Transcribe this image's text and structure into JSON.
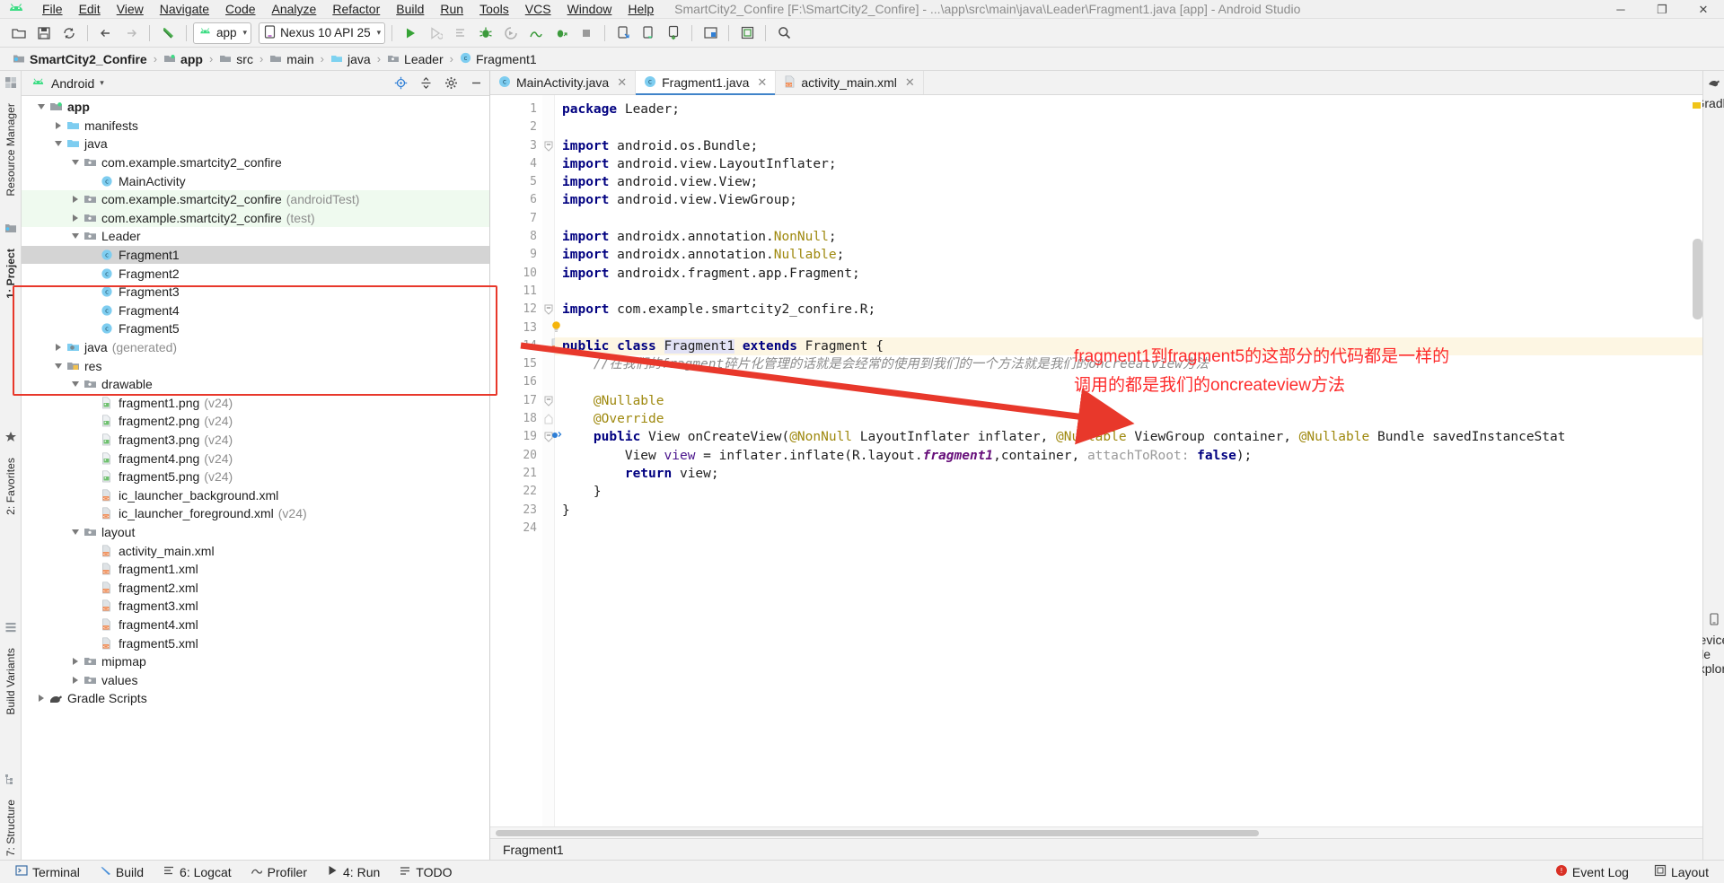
{
  "window": {
    "title": "SmartCity2_Confire [F:\\SmartCity2_Confire] - ...\\app\\src\\main\\java\\Leader\\Fragment1.java [app] - Android Studio",
    "minimize_label": "─",
    "maximize_label": "❐",
    "close_label": "✕"
  },
  "menubar": {
    "items": [
      {
        "label": "File"
      },
      {
        "label": "Edit"
      },
      {
        "label": "View"
      },
      {
        "label": "Navigate"
      },
      {
        "label": "Code"
      },
      {
        "label": "Analyze"
      },
      {
        "label": "Refactor"
      },
      {
        "label": "Build"
      },
      {
        "label": "Run"
      },
      {
        "label": "Tools"
      },
      {
        "label": "VCS"
      },
      {
        "label": "Window"
      },
      {
        "label": "Help"
      }
    ]
  },
  "toolbar": {
    "open_icon": "open-folder-icon",
    "save_icon": "save-icon",
    "sync_icon": "sync-project-icon",
    "back_icon": "navigate-back-icon",
    "forward_icon": "navigate-forward-icon",
    "undo_icon": "undo-icon",
    "module_combo": {
      "label": "app",
      "icon": "android-module-icon",
      "caret": "▾"
    },
    "device_combo": {
      "label": "Nexus 10 API 25",
      "icon": "device-icon",
      "caret": "▾"
    },
    "run_icon": "run-icon",
    "apply_changes_icon": "apply-changes-icon",
    "apply_code_changes_icon": "apply-code-changes-icon",
    "debug_icon": "debug-icon",
    "run_coverage_icon": "run-with-coverage-icon",
    "profile_icon": "profiler-icon",
    "attach_debugger_icon": "attach-debugger-icon",
    "stop_icon": "stop-icon",
    "avd_manager_icon": "avd-manager-icon",
    "sdk_manager_icon": "sdk-manager-icon",
    "device_file_explorer_icon": "device-explorer-icon",
    "project_structure_icon": "project-structure-icon",
    "layout_inspector_icon": "layout-inspector-icon",
    "search_icon": "search-everywhere-icon"
  },
  "breadcrumb": {
    "items": [
      {
        "label": "SmartCity2_Confire",
        "icon": "project-icon",
        "bold": true
      },
      {
        "label": "app",
        "icon": "module-icon",
        "bold": true
      },
      {
        "label": "src",
        "icon": "folder-icon",
        "bold": false
      },
      {
        "label": "main",
        "icon": "folder-icon",
        "bold": false
      },
      {
        "label": "java",
        "icon": "source-folder-icon",
        "bold": false
      },
      {
        "label": "Leader",
        "icon": "package-icon",
        "bold": false
      },
      {
        "label": "Fragment1",
        "icon": "class-icon",
        "bold": false
      }
    ],
    "separator": "›"
  },
  "left_rail": {
    "items": [
      {
        "label": "Resource Manager",
        "icon": "resource-manager-icon"
      },
      {
        "label": "1: Project",
        "icon": "project-tool-icon"
      },
      {
        "label": "2: Favorites",
        "icon": "favorites-icon"
      },
      {
        "label": "Build Variants",
        "icon": "build-variants-icon"
      },
      {
        "label": "7: Structure",
        "icon": "structure-icon"
      }
    ]
  },
  "right_rail": {
    "items": [
      {
        "label": "Gradle",
        "icon": "gradle-icon"
      },
      {
        "label": "Device File Explorer",
        "icon": "device-file-explorer-icon"
      }
    ]
  },
  "project_panel": {
    "view_selector": {
      "label": "Android",
      "icon": "android-head-icon",
      "caret": "▾"
    },
    "header_buttons": [
      {
        "name": "locate-icon",
        "label": "⌖"
      },
      {
        "name": "collapse-all-icon",
        "label": "⤓"
      },
      {
        "name": "settings-gear-icon",
        "label": "⚙"
      },
      {
        "name": "hide-panel-icon",
        "label": "─"
      }
    ],
    "tree": [
      {
        "indent": 0,
        "twisty": "down",
        "icon": "module-icon",
        "label": "app",
        "bold": true,
        "suffix": ""
      },
      {
        "indent": 1,
        "twisty": "right",
        "icon": "folder-icon",
        "label": "manifests",
        "bold": false,
        "suffix": ""
      },
      {
        "indent": 1,
        "twisty": "down",
        "icon": "folder-icon",
        "label": "java",
        "bold": false,
        "suffix": ""
      },
      {
        "indent": 2,
        "twisty": "down",
        "icon": "package-icon",
        "label": "com.example.smartcity2_confire",
        "bold": false,
        "suffix": ""
      },
      {
        "indent": 3,
        "twisty": "none",
        "icon": "class-icon",
        "label": "MainActivity",
        "bold": false,
        "suffix": ""
      },
      {
        "indent": 2,
        "twisty": "right",
        "icon": "package-icon",
        "label": "com.example.smartcity2_confire",
        "bold": false,
        "suffix": "(androidTest)",
        "bg": "test"
      },
      {
        "indent": 2,
        "twisty": "right",
        "icon": "package-icon",
        "label": "com.example.smartcity2_confire",
        "bold": false,
        "suffix": "(test)",
        "bg": "test"
      },
      {
        "indent": 2,
        "twisty": "down",
        "icon": "package-icon",
        "label": "Leader",
        "bold": false,
        "suffix": ""
      },
      {
        "indent": 3,
        "twisty": "none",
        "icon": "class-icon",
        "label": "Fragment1",
        "bold": false,
        "suffix": "",
        "bg": "sel"
      },
      {
        "indent": 3,
        "twisty": "none",
        "icon": "class-icon",
        "label": "Fragment2",
        "bold": false,
        "suffix": ""
      },
      {
        "indent": 3,
        "twisty": "none",
        "icon": "class-icon",
        "label": "Fragment3",
        "bold": false,
        "suffix": ""
      },
      {
        "indent": 3,
        "twisty": "none",
        "icon": "class-icon",
        "label": "Fragment4",
        "bold": false,
        "suffix": ""
      },
      {
        "indent": 3,
        "twisty": "none",
        "icon": "class-icon",
        "label": "Fragment5",
        "bold": false,
        "suffix": ""
      },
      {
        "indent": 1,
        "twisty": "right",
        "icon": "generated-folder-icon",
        "label": "java",
        "bold": false,
        "suffix": "(generated)"
      },
      {
        "indent": 1,
        "twisty": "down",
        "icon": "res-folder-icon",
        "label": "res",
        "bold": false,
        "suffix": ""
      },
      {
        "indent": 2,
        "twisty": "down",
        "icon": "package-icon",
        "label": "drawable",
        "bold": false,
        "suffix": ""
      },
      {
        "indent": 3,
        "twisty": "none",
        "icon": "image-file-icon",
        "label": "fragment1.png",
        "bold": false,
        "suffix": "(v24)"
      },
      {
        "indent": 3,
        "twisty": "none",
        "icon": "image-file-icon",
        "label": "fragment2.png",
        "bold": false,
        "suffix": "(v24)"
      },
      {
        "indent": 3,
        "twisty": "none",
        "icon": "image-file-icon",
        "label": "fragment3.png",
        "bold": false,
        "suffix": "(v24)"
      },
      {
        "indent": 3,
        "twisty": "none",
        "icon": "image-file-icon",
        "label": "fragment4.png",
        "bold": false,
        "suffix": "(v24)"
      },
      {
        "indent": 3,
        "twisty": "none",
        "icon": "image-file-icon",
        "label": "fragment5.png",
        "bold": false,
        "suffix": "(v24)"
      },
      {
        "indent": 3,
        "twisty": "none",
        "icon": "xml-file-icon",
        "label": "ic_launcher_background.xml",
        "bold": false,
        "suffix": ""
      },
      {
        "indent": 3,
        "twisty": "none",
        "icon": "xml-file-icon",
        "label": "ic_launcher_foreground.xml",
        "bold": false,
        "suffix": "(v24)"
      },
      {
        "indent": 2,
        "twisty": "down",
        "icon": "package-icon",
        "label": "layout",
        "bold": false,
        "suffix": ""
      },
      {
        "indent": 3,
        "twisty": "none",
        "icon": "xml-file-icon",
        "label": "activity_main.xml",
        "bold": false,
        "suffix": ""
      },
      {
        "indent": 3,
        "twisty": "none",
        "icon": "xml-file-icon",
        "label": "fragment1.xml",
        "bold": false,
        "suffix": ""
      },
      {
        "indent": 3,
        "twisty": "none",
        "icon": "xml-file-icon",
        "label": "fragment2.xml",
        "bold": false,
        "suffix": ""
      },
      {
        "indent": 3,
        "twisty": "none",
        "icon": "xml-file-icon",
        "label": "fragment3.xml",
        "bold": false,
        "suffix": ""
      },
      {
        "indent": 3,
        "twisty": "none",
        "icon": "xml-file-icon",
        "label": "fragment4.xml",
        "bold": false,
        "suffix": ""
      },
      {
        "indent": 3,
        "twisty": "none",
        "icon": "xml-file-icon",
        "label": "fragment5.xml",
        "bold": false,
        "suffix": ""
      },
      {
        "indent": 2,
        "twisty": "right",
        "icon": "package-icon",
        "label": "mipmap",
        "bold": false,
        "suffix": ""
      },
      {
        "indent": 2,
        "twisty": "right",
        "icon": "package-icon",
        "label": "values",
        "bold": false,
        "suffix": ""
      },
      {
        "indent": 0,
        "twisty": "right",
        "icon": "gradle-elephant-icon",
        "label": "Gradle Scripts",
        "bold": false,
        "suffix": ""
      }
    ]
  },
  "editor": {
    "tabs": [
      {
        "label": "MainActivity.java",
        "icon": "java-class-icon",
        "active": false,
        "close": "✕"
      },
      {
        "label": "Fragment1.java",
        "icon": "java-class-icon",
        "active": true,
        "close": "✕"
      },
      {
        "label": "activity_main.xml",
        "icon": "xml-file-icon",
        "active": false,
        "close": "✕"
      }
    ],
    "line_numbers": [
      1,
      2,
      3,
      4,
      5,
      6,
      7,
      8,
      9,
      10,
      11,
      12,
      13,
      14,
      15,
      16,
      17,
      18,
      19,
      20,
      21,
      22,
      23,
      24
    ],
    "code_lines": [
      {
        "n": 1,
        "tokens": [
          {
            "t": "package",
            "c": "kw"
          },
          {
            "t": " Leader;",
            "c": ""
          }
        ]
      },
      {
        "n": 2,
        "tokens": []
      },
      {
        "n": 3,
        "tokens": [
          {
            "t": "import",
            "c": "kw"
          },
          {
            "t": " android.os.Bundle;",
            "c": ""
          }
        ],
        "fold": "start"
      },
      {
        "n": 4,
        "tokens": [
          {
            "t": "import",
            "c": "kw"
          },
          {
            "t": " android.view.LayoutInflater;",
            "c": ""
          }
        ]
      },
      {
        "n": 5,
        "tokens": [
          {
            "t": "import",
            "c": "kw"
          },
          {
            "t": " android.view.View;",
            "c": ""
          }
        ]
      },
      {
        "n": 6,
        "tokens": [
          {
            "t": "import",
            "c": "kw"
          },
          {
            "t": " android.view.ViewGroup;",
            "c": ""
          }
        ]
      },
      {
        "n": 7,
        "tokens": []
      },
      {
        "n": 8,
        "tokens": [
          {
            "t": "import",
            "c": "kw"
          },
          {
            "t": " androidx.annotation.",
            "c": ""
          },
          {
            "t": "NonNull",
            "c": "anno"
          },
          {
            "t": ";",
            "c": ""
          }
        ]
      },
      {
        "n": 9,
        "tokens": [
          {
            "t": "import",
            "c": "kw"
          },
          {
            "t": " androidx.annotation.",
            "c": ""
          },
          {
            "t": "Nullable",
            "c": "anno"
          },
          {
            "t": ";",
            "c": ""
          }
        ]
      },
      {
        "n": 10,
        "tokens": [
          {
            "t": "import",
            "c": "kw"
          },
          {
            "t": " androidx.fragment.app.Fragment;",
            "c": ""
          }
        ]
      },
      {
        "n": 11,
        "tokens": []
      },
      {
        "n": 12,
        "tokens": [
          {
            "t": "import",
            "c": "kw"
          },
          {
            "t": " com.example.smartcity2_confire.R;",
            "c": ""
          }
        ],
        "fold": "start"
      },
      {
        "n": 13,
        "tokens": [],
        "gutter_icon": "intention-bulb-icon"
      },
      {
        "n": 14,
        "tokens": [
          {
            "t": "public",
            "c": "kw"
          },
          {
            "t": " ",
            "c": ""
          },
          {
            "t": "class",
            "c": "kw"
          },
          {
            "t": " ",
            "c": ""
          },
          {
            "t": "Fragment1",
            "c": "clsname"
          },
          {
            "t": " ",
            "c": ""
          },
          {
            "t": "extends",
            "c": "kw"
          },
          {
            "t": " Fragment {",
            "c": ""
          }
        ],
        "highlight": true,
        "gutter_icon": "related-layout-icon"
      },
      {
        "n": 15,
        "tokens": [
          {
            "t": "    //在我们的fragment碎片化管理的话就是会经常的使用到我们的一个方法就是我们的oncreeatview方法",
            "c": "cmt"
          }
        ]
      },
      {
        "n": 16,
        "tokens": []
      },
      {
        "n": 17,
        "tokens": [
          {
            "t": "    @Nullable",
            "c": "anno"
          }
        ],
        "fold": "start"
      },
      {
        "n": 18,
        "tokens": [
          {
            "t": "    @Override",
            "c": "anno"
          }
        ],
        "fold": "end"
      },
      {
        "n": 19,
        "tokens": [
          {
            "t": "    ",
            "c": ""
          },
          {
            "t": "public",
            "c": "kw"
          },
          {
            "t": " View onCreateView(",
            "c": ""
          },
          {
            "t": "@NonNull",
            "c": "anno"
          },
          {
            "t": " LayoutInflater inflater, ",
            "c": ""
          },
          {
            "t": "@Nullable",
            "c": "anno"
          },
          {
            "t": " ViewGroup container, ",
            "c": ""
          },
          {
            "t": "@Nullable",
            "c": "anno"
          },
          {
            "t": " Bundle savedInstanceStat",
            "c": ""
          }
        ],
        "gutter_icon": "override-method-icon",
        "fold": "start"
      },
      {
        "n": 20,
        "tokens": [
          {
            "t": "        View ",
            "c": ""
          },
          {
            "t": "view",
            "c": "local"
          },
          {
            "t": " = inflater.inflate(R.layout.",
            "c": ""
          },
          {
            "t": "fragment1",
            "c": "fld"
          },
          {
            "t": ",container, ",
            "c": ""
          },
          {
            "t": "attachToRoot:",
            "c": "hint"
          },
          {
            "t": " ",
            "c": ""
          },
          {
            "t": "false",
            "c": "kw"
          },
          {
            "t": ");",
            "c": ""
          }
        ]
      },
      {
        "n": 21,
        "tokens": [
          {
            "t": "        ",
            "c": ""
          },
          {
            "t": "return",
            "c": "kw"
          },
          {
            "t": " view;",
            "c": ""
          }
        ]
      },
      {
        "n": 22,
        "tokens": [
          {
            "t": "    }",
            "c": ""
          }
        ]
      },
      {
        "n": 23,
        "tokens": [
          {
            "t": "}",
            "c": ""
          }
        ]
      },
      {
        "n": 24,
        "tokens": []
      }
    ],
    "status_text": "Fragment1"
  },
  "annotations": {
    "red_note_line1": "fragment1到fragment5的这部分的代码都是一样的",
    "red_note_line2": "调用的都是我们的oncreateview方法",
    "red_color": "#fd2b2b",
    "box_label": "fragment-selection-box",
    "arrow_label": "annotation-arrow"
  },
  "bottombar": {
    "items": [
      {
        "label": "Terminal",
        "icon": "terminal-icon"
      },
      {
        "label": "Build",
        "icon": "build-hammer-icon"
      },
      {
        "label": "6: Logcat",
        "icon": "logcat-icon"
      },
      {
        "label": "Profiler",
        "icon": "profiler-icon"
      },
      {
        "label": "4: Run",
        "icon": "run-icon"
      },
      {
        "label": "TODO",
        "icon": "todo-icon"
      }
    ],
    "right_items": [
      {
        "label": "Event Log",
        "icon": "event-log-icon"
      },
      {
        "label": "Layout",
        "icon": "layout-captures-icon"
      }
    ]
  },
  "colors": {
    "accent": "#4083c9",
    "android_green": "#3ddc84",
    "keyword": "#000080",
    "annotation": "#9e880d",
    "comment": "#8c8c8c",
    "selection": "#d4d4d4",
    "test_source": "#effaef",
    "highlight_line": "#fdf6e3"
  }
}
